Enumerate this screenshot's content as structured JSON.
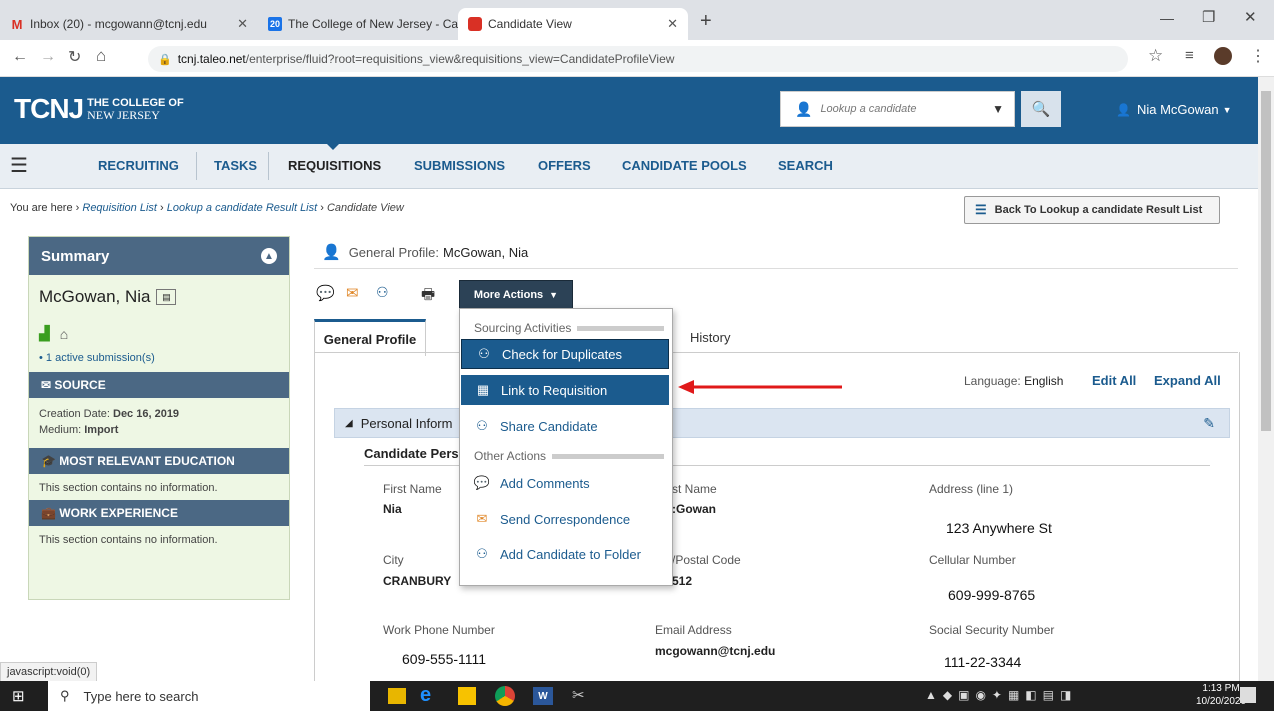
{
  "browser": {
    "tabs": [
      {
        "label": "Inbox (20) - mcgowann@tcnj.edu",
        "favicon": "M",
        "favicon_color": "#d93025"
      },
      {
        "label": "The College of New Jersey - Cale",
        "favicon": "20",
        "favicon_color": "#1a73e8"
      },
      {
        "label": "Candidate View",
        "favicon": "",
        "favicon_color": "#d93025"
      }
    ],
    "url_host": "tcnj.taleo.net",
    "url_path": "/enterprise/fluid?root=requisitions_view&requisitions_view=CandidateProfileView"
  },
  "header": {
    "logo_big": "TCNJ",
    "logo_line1": "THE COLLEGE OF",
    "logo_line2": "NEW JERSEY",
    "lookup_placeholder": "Lookup a candidate",
    "user_name": "Nia McGowan"
  },
  "nav": {
    "items": [
      "RECRUITING",
      "TASKS",
      "REQUISITIONS",
      "SUBMISSIONS",
      "OFFERS",
      "CANDIDATE POOLS",
      "SEARCH"
    ]
  },
  "breadcrumb": {
    "prefix": "You are here",
    "items": [
      "Requisition List",
      "Lookup a candidate Result List",
      "Candidate View"
    ],
    "back_button": "Back To Lookup a candidate Result List"
  },
  "summary": {
    "title": "Summary",
    "candidate_name": "McGowan, Nia",
    "active_submissions": "1 active submission(s)",
    "source_header": "SOURCE",
    "creation_date_label": "Creation Date:",
    "creation_date": "Dec 16, 2019",
    "medium_label": "Medium:",
    "medium": "Import",
    "education_header": "MOST RELEVANT EDUCATION",
    "education_text": "This section contains no information.",
    "work_header": "WORK EXPERIENCE",
    "work_text": "This section contains no information."
  },
  "profile": {
    "heading_label": "General Profile:",
    "heading_name": "McGowan, Nia",
    "more_actions": "More Actions",
    "tabs": [
      "General Profile",
      "History"
    ],
    "language_label": "Language:",
    "language": "English",
    "edit_all": "Edit All",
    "expand_all": "Expand All",
    "section_title": "Personal Inform",
    "subsection_title": "Candidate Pers",
    "fields": {
      "first_name_label": "First Name",
      "first_name": "Nia",
      "last_name_label": "st Name",
      "last_name": ":Gowan",
      "address_label": "Address (line 1)",
      "address": "123  Anywhere St",
      "city_label": "City",
      "city": "CRANBURY",
      "zip_label": "/Postal Code",
      "zip": "512",
      "cell_label": "Cellular Number",
      "cell": "609-999-8765",
      "work_phone_label": "Work Phone Number",
      "work_phone": "609-555-1111",
      "email_label": "Email Address",
      "email": "mcgowann@tcnj.edu",
      "ssn_label": "Social Security Number",
      "ssn": "111-22-3344"
    }
  },
  "menu": {
    "section1": "Sourcing Activities",
    "check_duplicates": "Check for Duplicates",
    "link_requisition": "Link to Requisition",
    "share_candidate": "Share Candidate",
    "section2": "Other Actions",
    "add_comments": "Add Comments",
    "send_correspondence": "Send Correspondence",
    "add_to_folder": "Add Candidate to Folder"
  },
  "status_bar": "javascript:void(0)",
  "taskbar": {
    "search_placeholder": "Type here to search",
    "time": "1:13 PM",
    "date": "10/20/2020"
  },
  "colors": {
    "brand": "#1b5b8e",
    "menu_highlight": "#1b5b8e",
    "arrow": "#e0191a"
  }
}
